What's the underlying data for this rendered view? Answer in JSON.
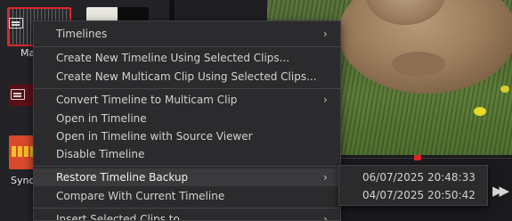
{
  "media_pool": {
    "clip_label_1": "Ma",
    "clip_label_2": "Sync"
  },
  "context_menu": {
    "items": [
      {
        "label": "Timelines",
        "has_submenu": true
      },
      {
        "label": "Create New Timeline Using Selected Clips..."
      },
      {
        "label": "Create New Multicam Clip Using Selected Clips..."
      },
      {
        "label": "Convert Timeline to Multicam Clip",
        "has_submenu": true
      },
      {
        "label": "Open in Timeline"
      },
      {
        "label": "Open in Timeline with Source Viewer"
      },
      {
        "label": "Disable Timeline"
      },
      {
        "label": "Restore Timeline Backup",
        "has_submenu": true,
        "highlighted": true
      },
      {
        "label": "Compare With Current Timeline"
      },
      {
        "label": "Insert Selected Clips to",
        "has_submenu": true
      }
    ]
  },
  "submenu": {
    "items": [
      {
        "label": "06/07/2025 20:48:33"
      },
      {
        "label": "04/07/2025 20:50:42"
      }
    ]
  },
  "icons": {
    "submenu_arrow": "chevron-right-icon",
    "timeline_clip": "timeline-icon",
    "fast_forward": "fast-forward-icon"
  },
  "colors": {
    "selection_border": "#e0232c",
    "menu_background": "#2b2b2d",
    "menu_highlight": "#3a3a3d"
  }
}
